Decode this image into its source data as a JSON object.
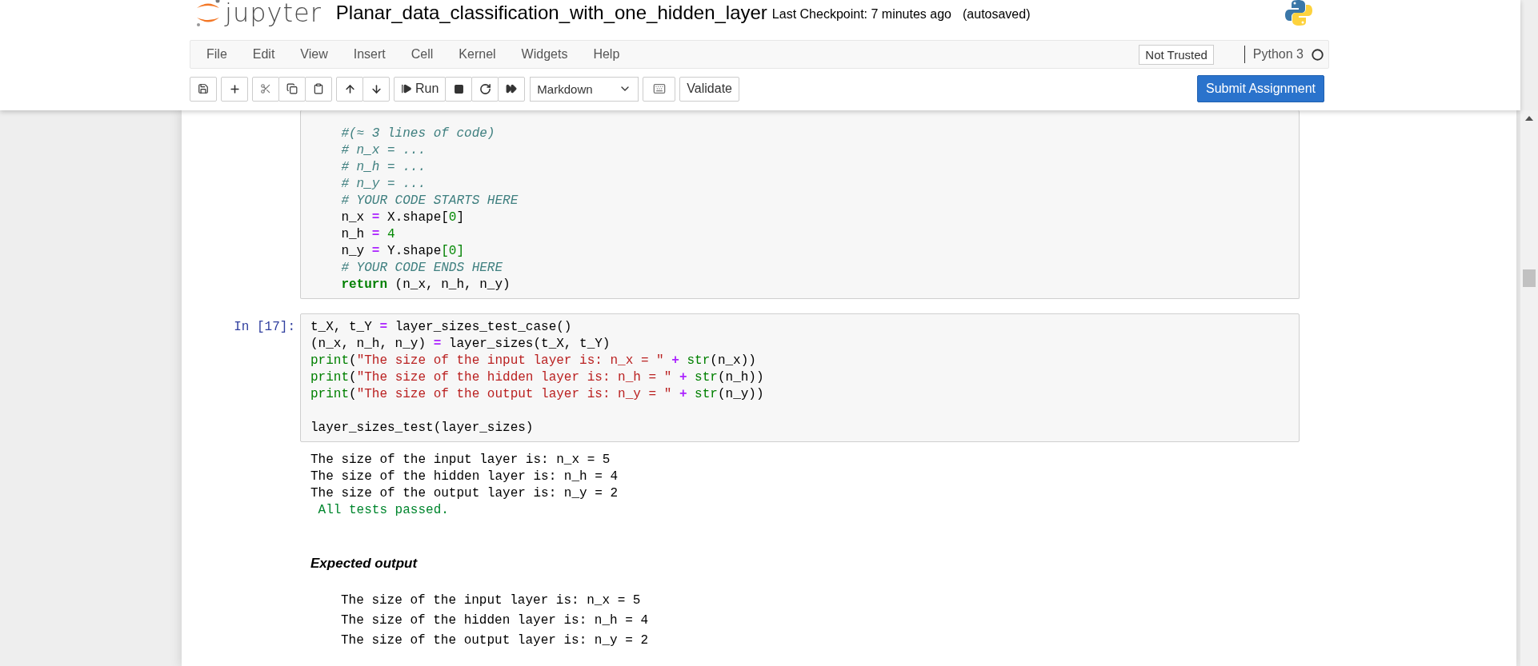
{
  "header": {
    "logo_text": "jupyter",
    "notebook_name": "Planar_data_classification_with_one_hidden_layer",
    "checkpoint": "Last Checkpoint: 7 minutes ago",
    "autosave_status": "(autosaved)"
  },
  "menu": [
    "File",
    "Edit",
    "View",
    "Insert",
    "Cell",
    "Kernel",
    "Widgets",
    "Help"
  ],
  "trust_status": "Not Trusted",
  "kernel_name": "Python 3",
  "toolbar": {
    "run_label": "Run",
    "cell_type": "Markdown",
    "validate_label": "Validate",
    "submit_label": "Submit Assignment"
  },
  "cells": [
    {
      "kind": "code",
      "lines": [
        {
          "tokens": [
            {
              "kind": "comment",
              "text": "    #(≈ 3 lines of code)"
            }
          ]
        },
        {
          "tokens": [
            {
              "kind": "comment",
              "text": "    # n_x = ... "
            }
          ]
        },
        {
          "tokens": [
            {
              "kind": "comment",
              "text": "    # n_h = ..."
            }
          ]
        },
        {
          "tokens": [
            {
              "kind": "comment",
              "text": "    # n_y = ... "
            }
          ]
        },
        {
          "tokens": [
            {
              "kind": "comment",
              "text": "    # YOUR CODE STARTS HERE"
            }
          ]
        },
        {
          "tokens": [
            {
              "kind": "plain",
              "text": "    n_x "
            },
            {
              "kind": "operator",
              "text": "="
            },
            {
              "kind": "plain",
              "text": " X.shape["
            },
            {
              "kind": "number",
              "text": "0"
            },
            {
              "kind": "plain",
              "text": "]"
            }
          ]
        },
        {
          "tokens": [
            {
              "kind": "plain",
              "text": "    n_h "
            },
            {
              "kind": "operator",
              "text": "="
            },
            {
              "kind": "number",
              "text": " 4"
            }
          ]
        },
        {
          "tokens": [
            {
              "kind": "plain",
              "text": "    n_y "
            },
            {
              "kind": "operator",
              "text": "="
            },
            {
              "kind": "plain",
              "text": " Y.shape"
            },
            {
              "kind": "builtin",
              "text": "["
            },
            {
              "kind": "number",
              "text": "0"
            },
            {
              "kind": "builtin",
              "text": "]"
            }
          ]
        },
        {
          "tokens": [
            {
              "kind": "comment",
              "text": "    # YOUR CODE ENDS HERE"
            }
          ]
        },
        {
          "tokens": [
            {
              "kind": "keyword",
              "text": "    return"
            },
            {
              "kind": "plain",
              "text": " (n_x, n_h, n_y)"
            }
          ]
        }
      ]
    },
    {
      "kind": "code",
      "prompt": "In [17]:",
      "lines": [
        {
          "tokens": [
            {
              "kind": "plain",
              "text": "t_X, t_Y "
            },
            {
              "kind": "operator",
              "text": "="
            },
            {
              "kind": "plain",
              "text": " layer_sizes_test_case()"
            }
          ]
        },
        {
          "tokens": [
            {
              "kind": "plain",
              "text": "(n_x, n_h, n_y) "
            },
            {
              "kind": "operator",
              "text": "="
            },
            {
              "kind": "plain",
              "text": " layer_sizes(t_X, t_Y)"
            }
          ]
        },
        {
          "tokens": [
            {
              "kind": "builtin",
              "text": "print"
            },
            {
              "kind": "plain",
              "text": "("
            },
            {
              "kind": "string",
              "text": "\"The size of the input layer is: n_x = \""
            },
            {
              "kind": "operator",
              "text": " + "
            },
            {
              "kind": "builtin",
              "text": "str"
            },
            {
              "kind": "plain",
              "text": "(n_x))"
            }
          ]
        },
        {
          "tokens": [
            {
              "kind": "builtin",
              "text": "print"
            },
            {
              "kind": "plain",
              "text": "("
            },
            {
              "kind": "string",
              "text": "\"The size of the hidden layer is: n_h = \""
            },
            {
              "kind": "operator",
              "text": " + "
            },
            {
              "kind": "builtin",
              "text": "str"
            },
            {
              "kind": "plain",
              "text": "(n_h))"
            }
          ]
        },
        {
          "tokens": [
            {
              "kind": "builtin",
              "text": "print"
            },
            {
              "kind": "plain",
              "text": "("
            },
            {
              "kind": "string",
              "text": "\"The size of the output layer is: n_y = \""
            },
            {
              "kind": "operator",
              "text": " + "
            },
            {
              "kind": "builtin",
              "text": "str"
            },
            {
              "kind": "plain",
              "text": "(n_y))"
            }
          ]
        },
        {
          "kind": "blank"
        },
        {
          "tokens": [
            {
              "kind": "plain",
              "text": "layer_sizes_test(layer_sizes)"
            }
          ]
        }
      ],
      "outputs": [
        {
          "kind": "stdout",
          "text": "The size of the input layer is: n_x = 5"
        },
        {
          "kind": "stdout",
          "text": "The size of the hidden layer is: n_h = 4"
        },
        {
          "kind": "stdout",
          "text": "The size of the output layer is: n_y = 2"
        },
        {
          "kind": "success",
          "text": " All tests passed."
        }
      ]
    },
    {
      "kind": "markdown",
      "heading": "Expected output",
      "pre": [
        "The size of the input layer is: n_x = 5",
        "The size of the hidden layer is: n_h = 4",
        "The size of the output layer is: n_y = 2"
      ]
    }
  ]
}
